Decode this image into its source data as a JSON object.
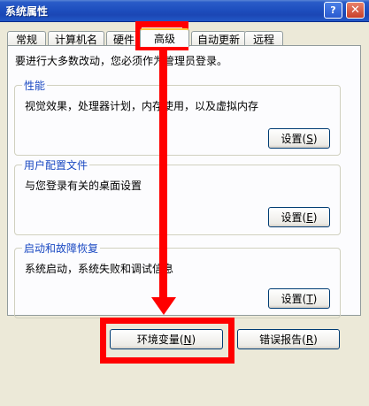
{
  "window": {
    "title": "系统属性",
    "help_glyph": "?",
    "close_glyph": "✕"
  },
  "tabs": [
    {
      "label": "常规"
    },
    {
      "label": "计算机名"
    },
    {
      "label": "硬件"
    },
    {
      "label": "高级"
    },
    {
      "label": "自动更新"
    },
    {
      "label": "远程"
    }
  ],
  "notice": "要进行大多数改动，您必须作为管理员登录。",
  "groups": {
    "performance": {
      "title": "性能",
      "desc": "视觉效果，处理器计划，内存使用，以及虚拟内存",
      "btn_label": "设置",
      "btn_key": "S"
    },
    "profile": {
      "title": "用户配置文件",
      "desc": "与您登录有关的桌面设置",
      "btn_label": "设置",
      "btn_key": "E"
    },
    "startup": {
      "title": "启动和故障恢复",
      "desc": "系统启动，系统失败和调试信息",
      "btn_label": "设置",
      "btn_key": "T"
    }
  },
  "bottom": {
    "env_label": "环境变量",
    "env_key": "N",
    "error_label": "错误报告",
    "error_key": "R"
  },
  "annotation_color": "#ff0000"
}
